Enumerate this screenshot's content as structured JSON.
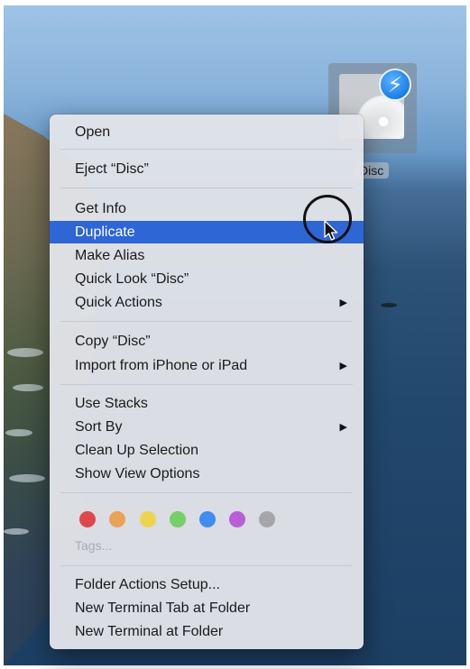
{
  "desktop": {
    "disc_label": "Disc",
    "disc_badge_icon": "lightning-bolt-icon"
  },
  "menu": {
    "open": "Open",
    "eject": "Eject “Disc”",
    "get_info": "Get Info",
    "duplicate": "Duplicate",
    "make_alias": "Make Alias",
    "quick_look": "Quick Look “Disc”",
    "quick_actions": "Quick Actions",
    "copy": "Copy “Disc”",
    "import": "Import from iPhone or iPad",
    "use_stacks": "Use Stacks",
    "sort_by": "Sort By",
    "clean_up": "Clean Up Selection",
    "view_options": "Show View Options",
    "tags": "Tags...",
    "folder_actions": "Folder Actions Setup...",
    "new_terminal_tab": "New Terminal Tab at Folder",
    "new_terminal": "New Terminal at Folder",
    "submenu_arrow": "▶",
    "selected_item": "Duplicate"
  },
  "tag_colors": {
    "red": "#e0474c",
    "orange": "#e8a356",
    "yellow": "#eed34f",
    "green": "#76cf6a",
    "blue": "#3f8df0",
    "purple": "#b85fd6",
    "gray": "#a6a6aa"
  }
}
